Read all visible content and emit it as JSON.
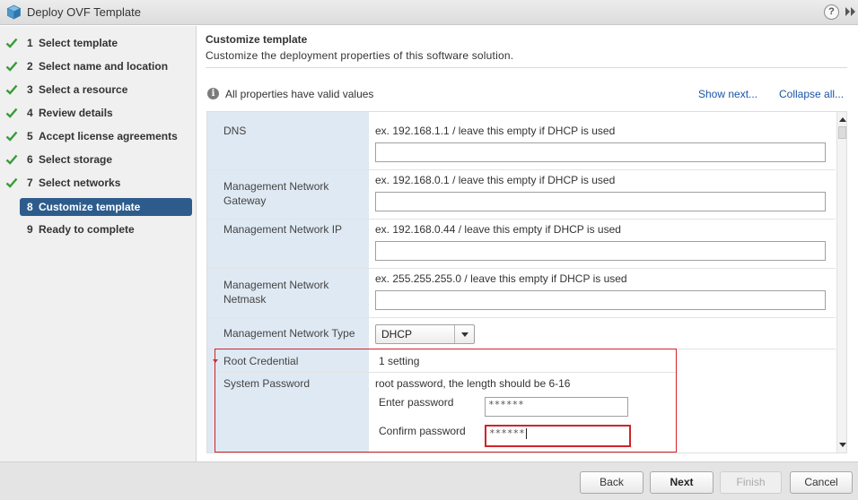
{
  "window": {
    "title": "Deploy OVF Template",
    "help_label": "?"
  },
  "steps": [
    {
      "num": "1",
      "label": "Select template",
      "done": true
    },
    {
      "num": "2",
      "label": "Select name and location",
      "done": true
    },
    {
      "num": "3",
      "label": "Select a resource",
      "done": true
    },
    {
      "num": "4",
      "label": "Review details",
      "done": true
    },
    {
      "num": "5",
      "label": "Accept license agreements",
      "done": true
    },
    {
      "num": "6",
      "label": "Select storage",
      "done": true
    },
    {
      "num": "7",
      "label": "Select networks",
      "done": true
    },
    {
      "num": "8",
      "label": "Customize template",
      "active": true
    },
    {
      "num": "9",
      "label": "Ready to complete"
    }
  ],
  "main": {
    "title": "Customize template",
    "subtitle": "Customize the deployment properties of this software solution.",
    "status": "All properties have valid values",
    "show_next": "Show next...",
    "collapse_all": "Collapse all..."
  },
  "properties": {
    "dns": {
      "label": "DNS",
      "hint": "ex. 192.168.1.1 / leave this empty if DHCP is used",
      "value": ""
    },
    "gateway": {
      "label_line1": "Management Network",
      "label_line2": "Gateway",
      "hint": "ex. 192.168.0.1 / leave this empty if DHCP is used",
      "value": ""
    },
    "ip": {
      "label": "Management Network IP",
      "hint": "ex. 192.168.0.44 / leave this empty if DHCP is used",
      "value": ""
    },
    "netmask": {
      "label_line1": "Management Network",
      "label_line2": "Netmask",
      "hint": "ex. 255.255.255.0 / leave this empty if DHCP is used",
      "value": ""
    },
    "type": {
      "label": "Management Network Type",
      "selected": "DHCP"
    },
    "root_credential": {
      "label": "Root Credential",
      "summary": "1 setting"
    },
    "system_password": {
      "label": "System Password",
      "hint": "root password, the length should be 6-16",
      "enter_label": "Enter password",
      "enter_value": "******",
      "confirm_label": "Confirm password",
      "confirm_value": "******"
    }
  },
  "footer": {
    "back": "Back",
    "next": "Next",
    "finish": "Finish",
    "cancel": "Cancel"
  },
  "colors": {
    "active_step_bg": "#2d5c8c",
    "check_green": "#3a9a3a",
    "link": "#1a54a8",
    "highlight_red": "#d0232a",
    "label_column_bg": "#dfe9f3"
  },
  "icons": {
    "app": "ovf-package-icon",
    "help": "help-icon",
    "expand": "double-chevron-right-icon",
    "step_done": "checkmark-icon",
    "info": "info-icon",
    "dropdown": "chevron-down-icon",
    "collapse": "triangle-down-icon"
  }
}
